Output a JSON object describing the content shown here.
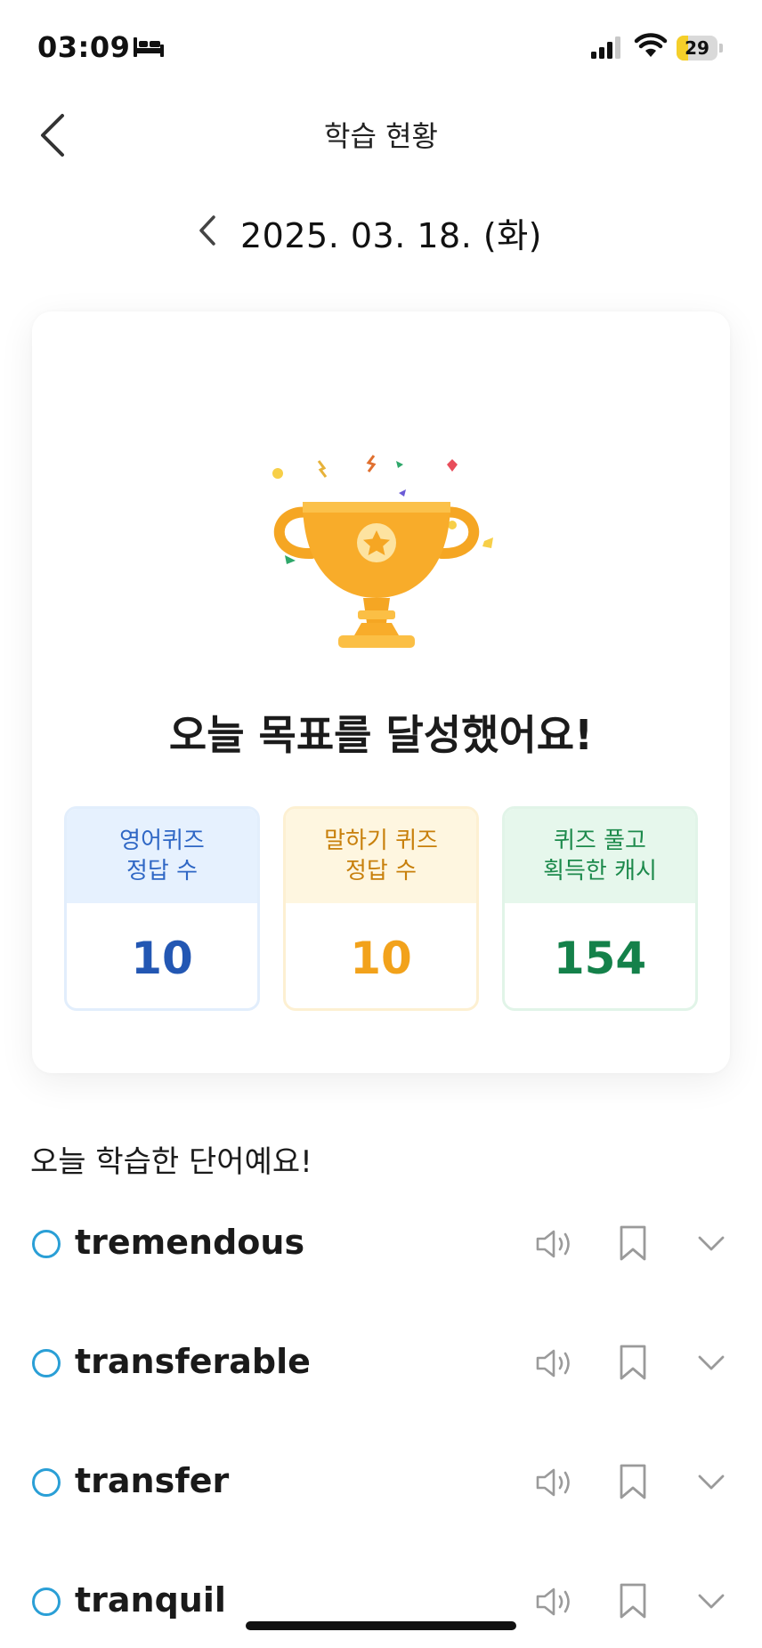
{
  "status_bar": {
    "time": "03:09",
    "battery_level": "29",
    "battery_fraction": 0.29
  },
  "nav": {
    "title": "학습 현황",
    "back_icon": "chevron-left-icon"
  },
  "date": {
    "label": "2025. 03. 18. (화)",
    "prev_icon": "chevron-left-icon"
  },
  "summary": {
    "goal_message": "오늘 목표를 달성했어요!",
    "trophy_icon": "trophy-icon",
    "stats": [
      {
        "label_line1": "영어퀴즈",
        "label_line2": "정답 수",
        "value": "10",
        "accent": "#2357b3"
      },
      {
        "label_line1": "말하기 퀴즈",
        "label_line2": "정답 수",
        "value": "10",
        "accent": "#f2a21b"
      },
      {
        "label_line1": "퀴즈 풀고",
        "label_line2": "획득한 캐시",
        "value": "154",
        "accent": "#14814a"
      }
    ]
  },
  "words_section": {
    "title": "오늘 학습한 단어예요!",
    "words": [
      {
        "word": "tremendous"
      },
      {
        "word": "transferable"
      },
      {
        "word": "transfer"
      },
      {
        "word": "tranquil"
      }
    ]
  },
  "colors": {
    "check_circle": "#2a9fd6",
    "icon_gray": "#9a9a9a"
  }
}
